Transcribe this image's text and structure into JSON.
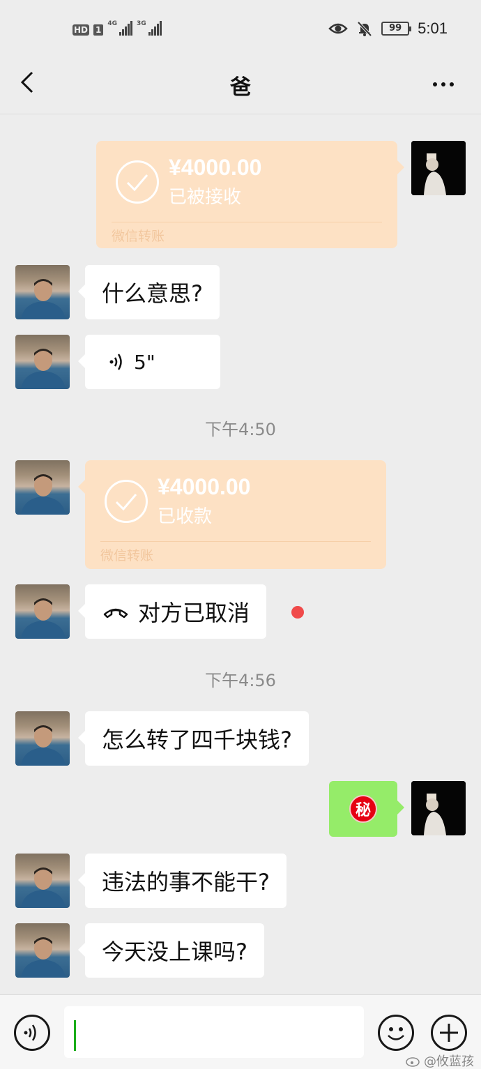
{
  "status_bar": {
    "hd_label": "HD",
    "sim_label": "1",
    "network_1": "4G",
    "network_2": "3G",
    "battery_level": "99",
    "time": "5:01",
    "icons": [
      "eye-icon",
      "bell-muted-icon",
      "battery-icon"
    ]
  },
  "header": {
    "title": "爸",
    "back_icon": "chevron-left-icon",
    "more_icon": "more-dots-icon"
  },
  "messages": [
    {
      "type": "transfer",
      "side": "right",
      "amount": "¥4000.00",
      "status": "已被接收",
      "footer": "微信转账"
    },
    {
      "type": "text",
      "side": "left",
      "text": "什么意思?"
    },
    {
      "type": "voice",
      "side": "left",
      "duration": "5\""
    },
    {
      "type": "timestamp",
      "text": "下午4:50"
    },
    {
      "type": "transfer",
      "side": "left",
      "amount": "¥4000.00",
      "status": "已收款",
      "footer": "微信转账"
    },
    {
      "type": "call",
      "side": "left",
      "text": "对方已取消",
      "unread": true
    },
    {
      "type": "timestamp",
      "text": "下午4:56"
    },
    {
      "type": "text",
      "side": "left",
      "text": "怎么转了四千块钱?"
    },
    {
      "type": "sticker",
      "side": "right",
      "text": "秘"
    },
    {
      "type": "text",
      "side": "left",
      "text": "违法的事不能干?"
    },
    {
      "type": "text",
      "side": "left",
      "text": "今天没上课吗?"
    }
  ],
  "input_bar": {
    "voice_icon": "voice-icon",
    "emoji_icon": "emoji-icon",
    "plus_icon": "plus-icon",
    "input_value": ""
  },
  "watermark": {
    "text": "@攸蓝孩"
  },
  "colors": {
    "background": "#ededed",
    "bubble_self": "#95ec69",
    "bubble_other": "#ffffff",
    "transfer_card": "#fde1c4",
    "unread_dot": "#f04a4a",
    "caret": "#1aad19"
  }
}
